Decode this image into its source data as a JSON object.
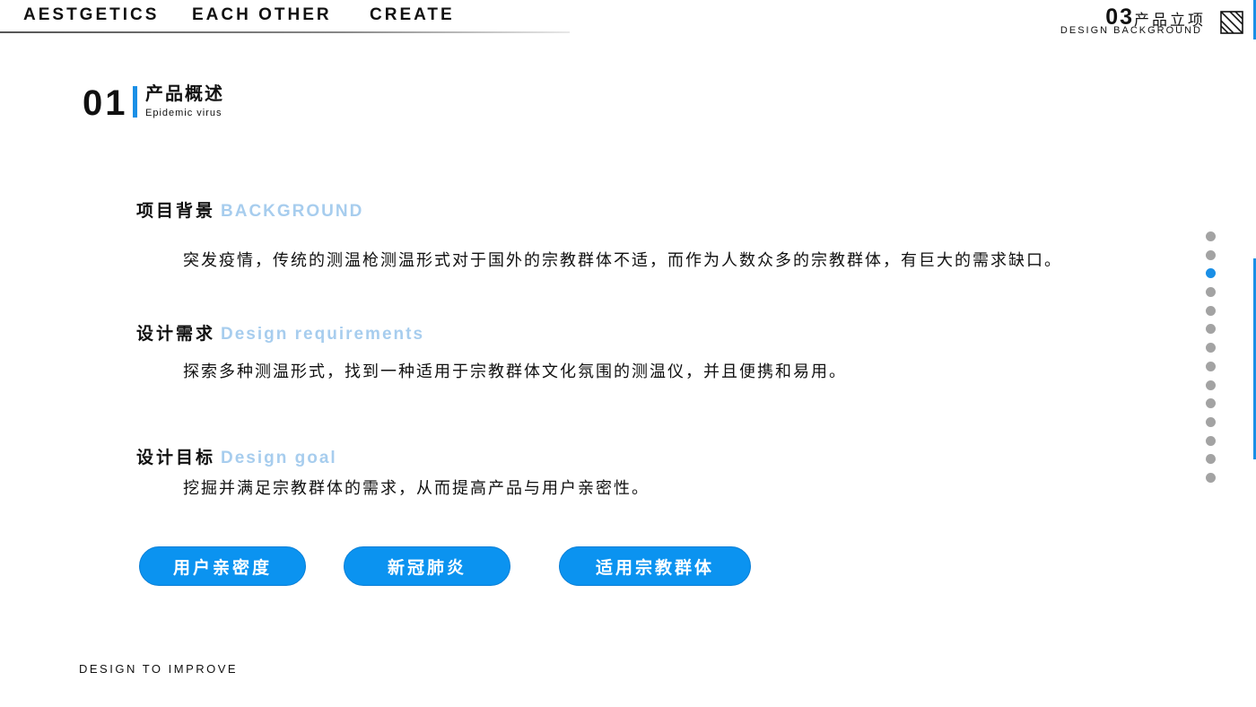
{
  "nav": {
    "items": [
      "AESTGETICS",
      "EACH OTHER",
      "CREATE"
    ]
  },
  "section_badge": {
    "number": "03",
    "title": "产品立项",
    "subtitle": "DESIGN BACKGROUND",
    "icon": "diagonal-stripes-icon"
  },
  "heading": {
    "number": "01",
    "title": "产品概述",
    "subtitle": "Epidemic virus"
  },
  "blocks": [
    {
      "title_cn": "项目背景",
      "title_en": "BACKGROUND",
      "text": "突发疫情，传统的测温枪测温形式对于国外的宗教群体不适，而作为人数众多的宗教群体，有巨大的需求缺口。"
    },
    {
      "title_cn": "设计需求",
      "title_en": "Design requirements",
      "text": "探索多种测温形式，找到一种适用于宗教群体文化氛围的测温仪，并且便携和易用。"
    },
    {
      "title_cn": "设计目标",
      "title_en": "Design goal",
      "text": "挖掘并满足宗教群体的需求，从而提高产品与用户亲密性。"
    }
  ],
  "tags": [
    "用户亲密度",
    "新冠肺炎",
    "适用宗教群体"
  ],
  "pagination": {
    "total": 14,
    "active_index": 2
  },
  "footer": "DESIGN TO IMPROVE",
  "colors": {
    "accent": "#1a8fe6",
    "pill": "#0b93f0",
    "english_title": "#a7cdee",
    "dot_inactive": "#a3a3a3"
  }
}
